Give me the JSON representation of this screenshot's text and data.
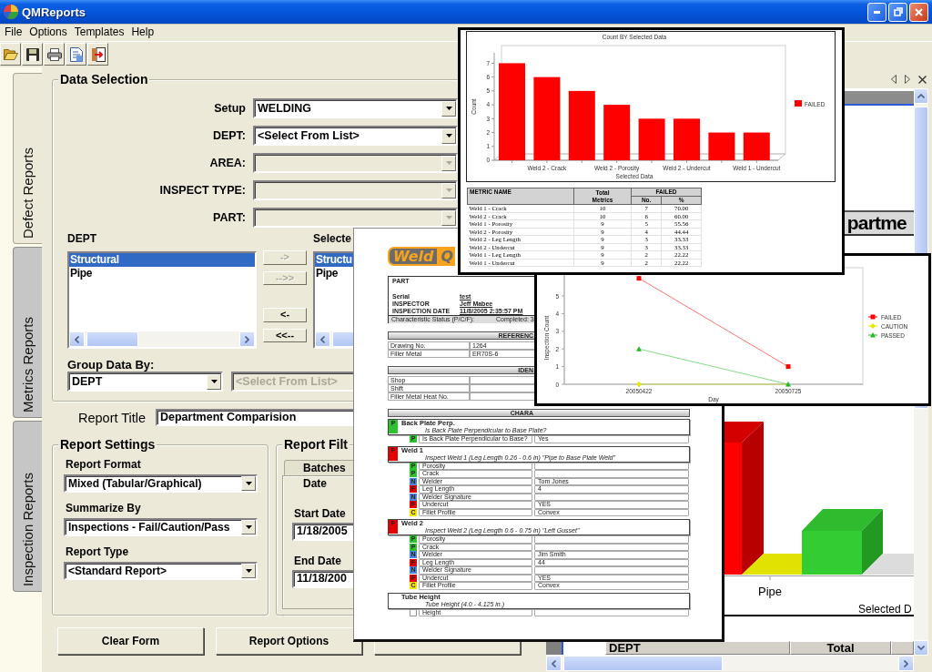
{
  "window": {
    "title": "QMReports"
  },
  "menu": [
    {
      "label": "File"
    },
    {
      "label": "Options"
    },
    {
      "label": "Templates"
    },
    {
      "label": "Help"
    }
  ],
  "side_tabs": [
    {
      "label": "Defect Reports",
      "selected": true
    },
    {
      "label": "Metrics Reports",
      "selected": false
    },
    {
      "label": "Inspection Reports",
      "selected": false
    }
  ],
  "data_selection": {
    "title": "Data Selection",
    "fields": [
      {
        "label": "Setup",
        "value": "WELDING",
        "disabled": false
      },
      {
        "label": "DEPT:",
        "value": "<Select From List>",
        "disabled": false
      },
      {
        "label": "AREA:",
        "disabled": true
      },
      {
        "label": "INSPECT TYPE:",
        "disabled": true
      },
      {
        "label": "PART:",
        "disabled": true
      }
    ],
    "available_list": {
      "label": "DEPT",
      "items": [
        {
          "text": "Structural",
          "selected": true
        },
        {
          "text": "Pipe",
          "selected": false
        }
      ]
    },
    "move_buttons": [
      {
        "label": "->",
        "disabled": true
      },
      {
        "label": "-->>",
        "disabled": true
      },
      {
        "label": "<-",
        "disabled": false
      },
      {
        "label": "<<--",
        "disabled": false
      }
    ],
    "selected_list": {
      "label": "Selecte",
      "items": [
        {
          "text": "Structu",
          "selected": true
        },
        {
          "text": "Pipe",
          "selected": false
        }
      ]
    },
    "group_by": {
      "label": "Group Data By:",
      "value": "DEPT",
      "second_value": "<Select From List>",
      "second_disabled": true
    }
  },
  "report_title": {
    "label": "Report Title",
    "value": "Department Comparision"
  },
  "report_settings": {
    "title": "Report Settings",
    "fields": [
      {
        "label": "Report Format",
        "value": "Mixed (Tabular/Graphical)"
      },
      {
        "label": "Summarize By",
        "value": "Inspections - Fail/Caution/Pass"
      },
      {
        "label": "Report Type",
        "value": "<Standard Report>"
      }
    ]
  },
  "report_filter": {
    "title": "Report Filt",
    "tabs": [
      {
        "label": "Batches",
        "selected": false
      },
      {
        "label": "Date",
        "selected": true
      }
    ],
    "fields": [
      {
        "label": "Start Date",
        "value": "1/18/2005"
      },
      {
        "label": "End Date",
        "value": "11/18/200"
      }
    ]
  },
  "buttons": [
    {
      "label": "Clear Form"
    },
    {
      "label": "Report Options"
    }
  ],
  "viewer": {
    "heading": "partme",
    "category_label": "Pipe",
    "axis_title": "Selected D",
    "table_columns": [
      "DEPT",
      "Total"
    ]
  },
  "bar_chart": {
    "chart_data": {
      "type": "bar",
      "title": "Count BY Selected Data",
      "xlabel": "Selected Data",
      "ylabel": "Count",
      "categories": [
        null,
        "Weld 2 - Crack",
        null,
        "Weld 2 - Porosity",
        null,
        "Weld 2 - Undercut",
        null,
        "Weld 1 - Undercut"
      ],
      "series": [
        {
          "name": "FAILED",
          "color": "#ff0000",
          "values": [
            7,
            6,
            5,
            4,
            3,
            3,
            2,
            2
          ]
        }
      ],
      "yticks": [
        0,
        1,
        2,
        3,
        4,
        5,
        6,
        7
      ],
      "ylim": [
        0,
        7.75
      ],
      "legend": "right"
    },
    "table": {
      "columns": [
        {
          "label": "METRIC NAME"
        },
        {
          "label": "Total Metrics"
        },
        {
          "label": "No."
        },
        {
          "label": "%"
        }
      ],
      "column_groups": [
        {
          "label": "FAILED",
          "colspan": 2
        }
      ],
      "rows": [
        [
          "Weld 1 - Crack",
          "10",
          "7",
          "70.00"
        ],
        [
          "Weld 2 - Crack",
          "10",
          "6",
          "60.00"
        ],
        [
          "Weld 1 - Porosity",
          "9",
          "5",
          "55.56"
        ],
        [
          "Weld 2 - Porosity",
          "9",
          "4",
          "44.44"
        ],
        [
          "Weld 2 - Leg Length",
          "9",
          "3",
          "33.33"
        ],
        [
          "Weld 2 - Undercut",
          "9",
          "3",
          "33.33"
        ],
        [
          "Weld 1 - Leg Length",
          "9",
          "2",
          "22.22"
        ],
        [
          "Weld 1 - Undercut",
          "9",
          "2",
          "22.22"
        ]
      ]
    }
  },
  "line_chart": {
    "chart_data": {
      "type": "line",
      "xlabel": "Day",
      "ylabel": "Inspection Count",
      "categories": [
        "20050422",
        "20050725"
      ],
      "series": [
        {
          "name": "FAILED",
          "color": "#ff0000",
          "marker": "square",
          "values": [
            6,
            1
          ]
        },
        {
          "name": "CAUTION",
          "color": "#e8e800",
          "marker": "diamond",
          "values": [
            0,
            0
          ]
        },
        {
          "name": "PASSED",
          "color": "#22bb22",
          "marker": "triangle",
          "values": [
            2,
            0
          ]
        }
      ],
      "yticks": [
        0,
        1,
        2,
        3,
        4,
        5
      ],
      "ylim": [
        0,
        6.6
      ],
      "legend": "right"
    }
  },
  "document": {
    "logo": {
      "word": "Weld",
      "letter": "Q"
    },
    "header": [
      {
        "label": "PART"
      },
      {
        "label": "Serial",
        "value": "test"
      },
      {
        "label": "INSPECTOR",
        "value": "Jeff Mabee"
      },
      {
        "label": "INSPECTION DATE",
        "value": "11/8/2005 2:35:57 PM"
      }
    ],
    "status_line": [
      "Characteristic Status (P/C/F):",
      "Completed: 3"
    ],
    "sections": [
      {
        "heading": "REFERENC",
        "rows": [
          {
            "label": "Drawing No.",
            "value": "1264"
          },
          {
            "label": "Filler Metal",
            "value": "ER70S-6"
          }
        ]
      },
      {
        "heading": "IDEN",
        "rows": [
          {
            "label": "Shop"
          },
          {
            "label": "Shift"
          },
          {
            "label": "Filler Metal Heat No."
          }
        ]
      },
      {
        "heading": "CHARA"
      }
    ],
    "characteristics": [
      {
        "name": "Back Plate Perp.",
        "status": "P",
        "color": "#2ec32e",
        "description": "Is Back Plate Perpendicular to Base Plate?",
        "checks": [
          {
            "status": "P",
            "color": "#2ec32e",
            "label": "Is Back Plate Perpendicular to Base?",
            "value": "Yes"
          }
        ]
      },
      {
        "name": "Weld 1",
        "status": "F",
        "color": "#e60000",
        "description": "Inspect Weld 1 (Leg Length 0.26 - 0.6 in) \"Pipe to Base Plate Weld\"",
        "checks": [
          {
            "status": "P",
            "color": "#2ec32e",
            "label": "Porosity"
          },
          {
            "status": "P",
            "color": "#2ec32e",
            "label": "Crack"
          },
          {
            "status": "N",
            "color": "#4d86d9",
            "label": "Welder",
            "value": "Tom Jones"
          },
          {
            "status": "F",
            "color": "#e60000",
            "label": "Leg Length",
            "value": "4"
          },
          {
            "status": "N",
            "color": "#4d86d9",
            "label": "Welder Signature"
          },
          {
            "status": "F",
            "color": "#e60000",
            "label": "Undercut",
            "value": "YES"
          },
          {
            "status": "C",
            "color": "#f2e600",
            "label": "Fillet Profile",
            "value": "Convex"
          }
        ]
      },
      {
        "name": "Weld 2",
        "status": "F",
        "color": "#e60000",
        "description": "Inspect Weld 2 (Leg Length 0.6 - 0.75 in) \"Left Gusset\"",
        "checks": [
          {
            "status": "P",
            "color": "#2ec32e",
            "label": "Porosity"
          },
          {
            "status": "P",
            "color": "#2ec32e",
            "label": "Crack"
          },
          {
            "status": "N",
            "color": "#4d86d9",
            "label": "Welder",
            "value": "Jim Smith"
          },
          {
            "status": "F",
            "color": "#e60000",
            "label": "Leg Length",
            "value": "44"
          },
          {
            "status": "N",
            "color": "#4d86d9",
            "label": "Welder Signature"
          },
          {
            "status": "F",
            "color": "#e60000",
            "label": "Undercut",
            "value": "YES"
          },
          {
            "status": "C",
            "color": "#f2e600",
            "label": "Fillet Profile",
            "value": "Convex"
          }
        ]
      },
      {
        "name": "Tube Height",
        "description": "Tube Height (4.0 - 4.125 in.)",
        "checks": [
          {
            "label": "Height"
          }
        ]
      }
    ]
  }
}
